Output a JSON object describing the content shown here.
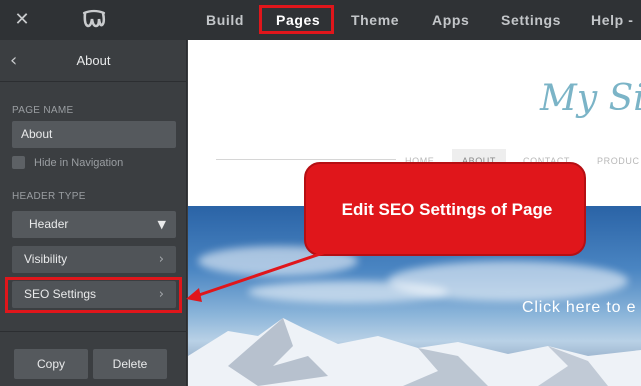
{
  "topbar": {
    "close_icon": "close-icon",
    "logo_icon": "weebly-logo-icon",
    "nav": [
      "Build",
      "Pages",
      "Theme",
      "Apps",
      "Settings",
      "Help"
    ],
    "help_suffix": "-",
    "active": "Pages",
    "highlight_color": "#e0161b"
  },
  "sidebar": {
    "back_icon": "chevron-left-icon",
    "title": "About",
    "page_name_label": "PAGE NAME",
    "page_name_value": "About",
    "hide_nav_label": "Hide in Navigation",
    "header_type_label": "HEADER TYPE",
    "header_type_value": "Header",
    "visibility_label": "Visibility",
    "seo_label": "SEO Settings",
    "copy_label": "Copy",
    "delete_label": "Delete"
  },
  "preview": {
    "site_title": "My Si",
    "nav": [
      "HOME",
      "ABOUT",
      "CONTACT",
      "PRODUC"
    ],
    "active_nav": "ABOUT",
    "hero_text": "Click here to e"
  },
  "callout": {
    "text": "Edit SEO Settings of Page",
    "color": "#e0161b"
  }
}
